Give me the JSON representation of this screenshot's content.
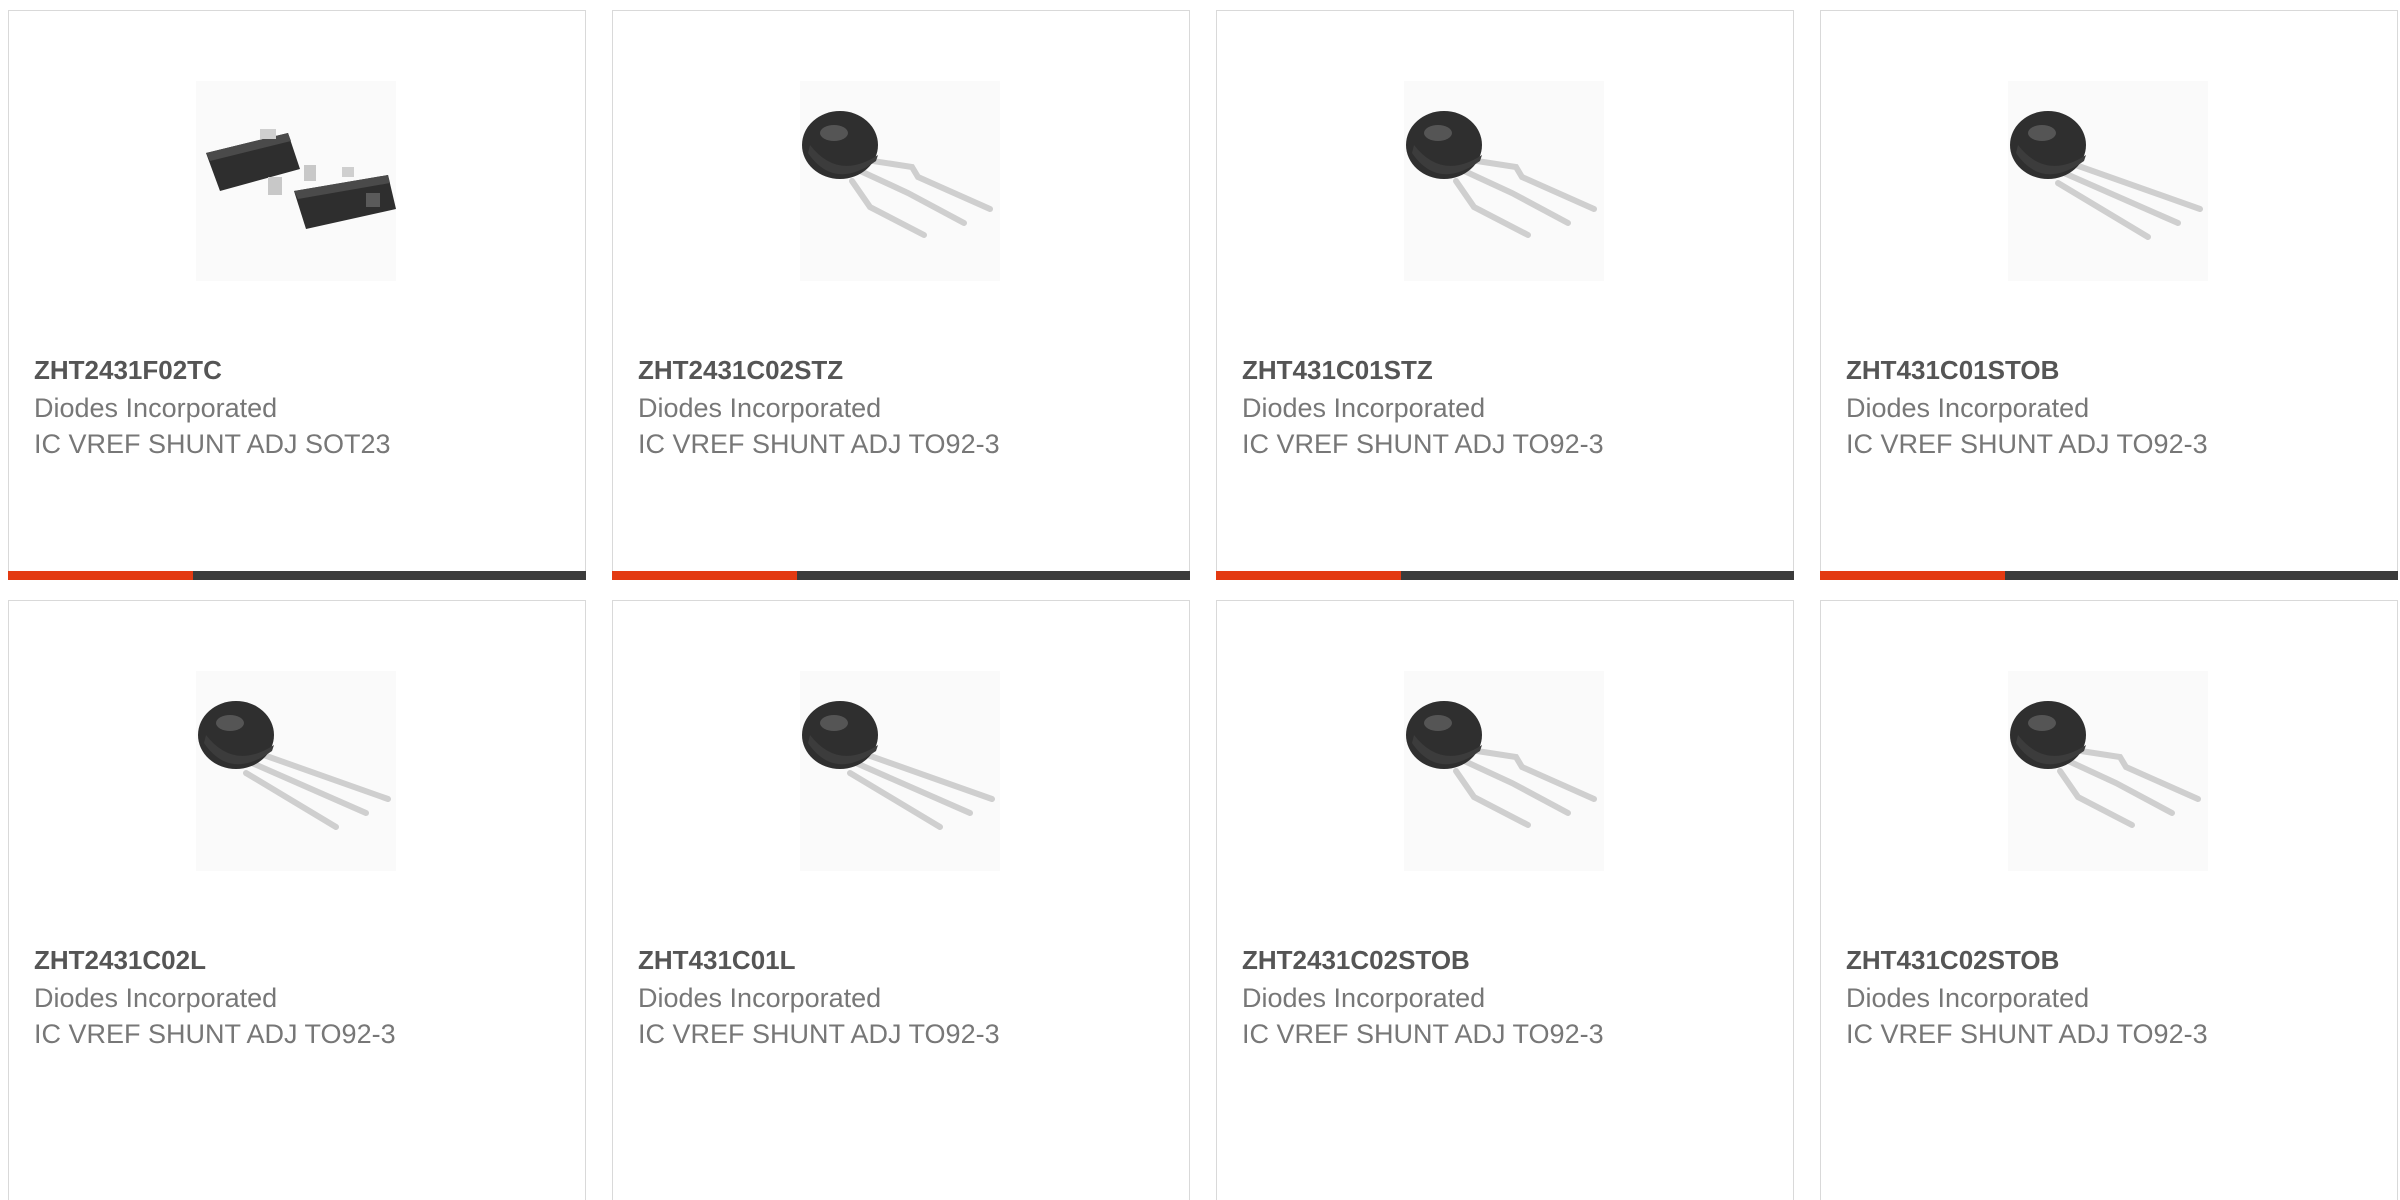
{
  "products": [
    {
      "part_number": "ZHT2431F02TC",
      "manufacturer": "Diodes Incorporated",
      "description": "IC VREF SHUNT ADJ SOT23",
      "package_icon": "sot23-package-icon",
      "progress_fraction": 0.32
    },
    {
      "part_number": "ZHT2431C02STZ",
      "manufacturer": "Diodes Incorporated",
      "description": "IC VREF SHUNT ADJ TO92-3",
      "package_icon": "to92-bent-leads-package-icon",
      "progress_fraction": 0.32
    },
    {
      "part_number": "ZHT431C01STZ",
      "manufacturer": "Diodes Incorporated",
      "description": "IC VREF SHUNT ADJ TO92-3",
      "package_icon": "to92-bent-leads-package-icon",
      "progress_fraction": 0.32
    },
    {
      "part_number": "ZHT431C01STOB",
      "manufacturer": "Diodes Incorporated",
      "description": "IC VREF SHUNT ADJ TO92-3",
      "package_icon": "to92-straight-leads-package-icon",
      "progress_fraction": 0.32
    },
    {
      "part_number": "ZHT2431C02L",
      "manufacturer": "Diodes Incorporated",
      "description": "IC VREF SHUNT ADJ TO92-3",
      "package_icon": "to92-straight-leads-package-icon"
    },
    {
      "part_number": "ZHT431C01L",
      "manufacturer": "Diodes Incorporated",
      "description": "IC VREF SHUNT ADJ TO92-3",
      "package_icon": "to92-straight-leads-package-icon"
    },
    {
      "part_number": "ZHT2431C02STOB",
      "manufacturer": "Diodes Incorporated",
      "description": "IC VREF SHUNT ADJ TO92-3",
      "package_icon": "to92-bent-leads-package-icon"
    },
    {
      "part_number": "ZHT431C02STOB",
      "manufacturer": "Diodes Incorporated",
      "description": "IC VREF SHUNT ADJ TO92-3",
      "package_icon": "to92-bent-leads-package-icon"
    }
  ],
  "colors": {
    "progress_fill": "#e33a12",
    "progress_track": "#3b3b3b",
    "part_number_text": "#555555",
    "meta_text": "#777777",
    "card_border": "#d9d9d9"
  }
}
